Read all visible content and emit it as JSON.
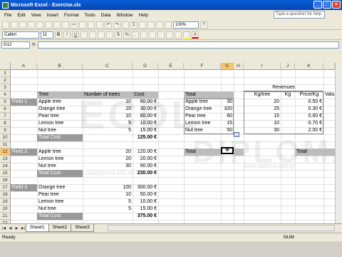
{
  "window": {
    "title": "Microsoft Excel - Exercise.xls",
    "help_placeholder": "Type a question for help"
  },
  "menu": [
    "File",
    "Edit",
    "View",
    "Insert",
    "Format",
    "Tools",
    "Data",
    "Window",
    "Help"
  ],
  "toolbar": {
    "font_name": "Calibri",
    "font_size": "11",
    "zoom": "100%"
  },
  "formula_bar": {
    "name_box": "G12",
    "fx": "fx",
    "content": ""
  },
  "columns": [
    "A",
    "B",
    "C",
    "D",
    "E",
    "F",
    "G",
    "H",
    "I",
    "J",
    "K"
  ],
  "rows": [
    "1",
    "2",
    "3",
    "4",
    "5",
    "6",
    "7",
    "8",
    "9",
    "10",
    "11",
    "12",
    "13",
    "14",
    "15",
    "16",
    "17",
    "18",
    "19",
    "20",
    "21",
    "22"
  ],
  "sheet": {
    "revenues_header": "Revenues",
    "headers": {
      "tree": "Tree",
      "number_of_trees": "Number of trees",
      "cost": "Cost",
      "total": "Total",
      "kg_tree": "Kg/tree",
      "kg": "Kg",
      "price_kg": "Price/Kg",
      "value": "Valu"
    },
    "field1": {
      "label": "Field 1",
      "rows": [
        {
          "tree": "Apple tree",
          "num": "10",
          "cost": "80.00 €"
        },
        {
          "tree": "Orange tree",
          "num": "10",
          "cost": "30.00 €"
        },
        {
          "tree": "Pear tree",
          "num": "10",
          "cost": "60.00 €"
        },
        {
          "tree": "Lemon tree",
          "num": "5",
          "cost": "10.00 €"
        },
        {
          "tree": "Nut tree",
          "num": "5",
          "cost": "15.00 €"
        }
      ],
      "total_label": "Total Cost",
      "total_value": "125.00 €"
    },
    "field2": {
      "label": "Field 2",
      "rows": [
        {
          "tree": "Apple tree",
          "num": "20",
          "cost": "120.00 €"
        },
        {
          "tree": "Lemon tree",
          "num": "20",
          "cost": "20.00 €"
        },
        {
          "tree": "Nut tree",
          "num": "30",
          "cost": "90.00 €"
        }
      ],
      "total_label": "Total Cost",
      "total_value": "230.00 €"
    },
    "field3": {
      "label": "Field 3",
      "rows": [
        {
          "tree": "Orange tree",
          "num": "100",
          "cost": "300.00 €"
        },
        {
          "tree": "Pear tree",
          "num": "10",
          "cost": "50.00 €"
        },
        {
          "tree": "Lemon tree",
          "num": "5",
          "cost": "10.00 €"
        },
        {
          "tree": "Nut tree",
          "num": "5",
          "cost": "15.00 €"
        }
      ],
      "total_label": "Total Cost",
      "total_value": "375.00 €"
    },
    "summary": {
      "rows": [
        {
          "tree": "Apple tree",
          "total": "30",
          "kg_tree": "20",
          "price": "0.50 €"
        },
        {
          "tree": "Orange tree",
          "total": "320",
          "kg_tree": "25",
          "price": "0.30 €"
        },
        {
          "tree": "Pear tree",
          "total": "60",
          "kg_tree": "15",
          "price": "0.60 €"
        },
        {
          "tree": "Lemon tree",
          "total": "15",
          "kg_tree": "10",
          "price": "0.70 €"
        },
        {
          "tree": "Nut tree",
          "total": "50",
          "kg_tree": "30",
          "price": "2.00 €"
        }
      ],
      "total_label_f12": "Total",
      "total_label_k12": "Total"
    }
  },
  "tabs": [
    "Sheet1",
    "Sheet2",
    "Sheet3"
  ],
  "status": {
    "left": "Ready",
    "right": "NUM"
  },
  "watermark": {
    "text1": "ECDL",
    "text2": "DIPLOMA",
    "url1": "www.askdiploma.edu.eu",
    "url2": "www.diploma.edu.gr"
  }
}
